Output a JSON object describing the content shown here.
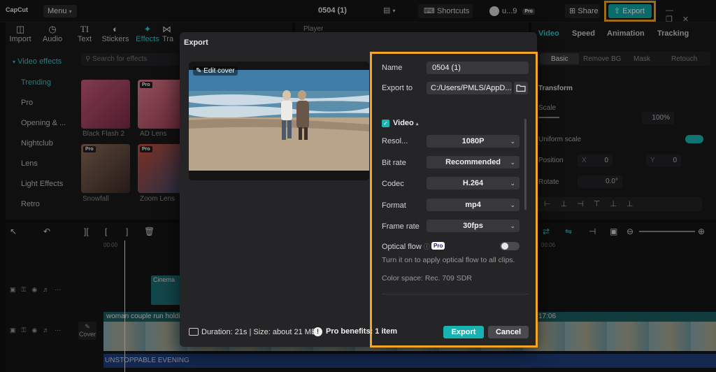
{
  "app": {
    "logo": "CapCut",
    "menu_label": "Menu",
    "project_title": "0504 (1)",
    "shortcuts_label": "Shortcuts",
    "user_label": "u...9",
    "user_badge": "Pro",
    "share_label": "Share",
    "export_label": "Export"
  },
  "toolbar_tabs": [
    {
      "label": "Import",
      "icon": "import-icon"
    },
    {
      "label": "Audio",
      "icon": "audio-icon"
    },
    {
      "label": "Text",
      "icon": "text-icon"
    },
    {
      "label": "Stickers",
      "icon": "stickers-icon"
    },
    {
      "label": "Effects",
      "icon": "effects-icon"
    },
    {
      "label": "Tra",
      "icon": "transitions-icon"
    }
  ],
  "effects_sidebar": {
    "header": "Video effects",
    "items": [
      "Trending",
      "Pro",
      "Opening & ...",
      "Nightclub",
      "Lens",
      "Light Effects",
      "Retro"
    ]
  },
  "search": {
    "placeholder": "Search for effects"
  },
  "effect_thumbs": [
    {
      "label": "Black Flash 2",
      "pro": ""
    },
    {
      "label": "AD Lens",
      "pro": "Pro"
    },
    {
      "label": "Snowfall",
      "pro": "Pro"
    },
    {
      "label": "Zoom Lens",
      "pro": "Pro"
    }
  ],
  "player": {
    "label": "Player"
  },
  "right_panel": {
    "tabs": [
      "Video",
      "Speed",
      "Animation",
      "Tracking"
    ],
    "subtabs": [
      "Basic",
      "Remove BG",
      "Mask",
      "Retouch"
    ],
    "transform_label": "Transform",
    "scale_label": "Scale",
    "scale_value": "100%",
    "uniform_scale_label": "Uniform scale",
    "position_label": "Position",
    "pos_x_label": "X",
    "pos_x_value": "0",
    "pos_y_label": "Y",
    "pos_y_value": "0",
    "rotate_label": "Rotate",
    "rotate_value": "0.0°"
  },
  "timeline": {
    "ruler_start": "00:00",
    "ruler_right": "00:06",
    "cover_label": "Cover",
    "clip_cinema": "Cinema",
    "clip_main": "woman couple run holdin",
    "clip_main_time": "17:06",
    "clip_audio": "UNSTOPPABLE EVENING"
  },
  "export_dialog": {
    "title": "Export",
    "edit_cover": "Edit cover",
    "name_label": "Name",
    "name_value": "0504 (1)",
    "export_to_label": "Export to",
    "export_to_value": "C:/Users/PMLS/AppD...",
    "video_section": "Video",
    "resolution_label": "Resol...",
    "resolution_value": "1080P",
    "bitrate_label": "Bit rate",
    "bitrate_value": "Recommended",
    "codec_label": "Codec",
    "codec_value": "H.264",
    "format_label": "Format",
    "format_value": "mp4",
    "framerate_label": "Frame rate",
    "framerate_value": "30fps",
    "optical_flow_label": "Optical flow",
    "optical_flow_badge": "Pro",
    "optical_flow_hint": "Turn it on to apply optical flow to all clips.",
    "color_space": "Color space: Rec. 709 SDR",
    "footer_info": "Duration: 21s | Size: about 21 MB",
    "pro_benefits": "Pro benefits: 1 item",
    "export_button": "Export",
    "cancel_button": "Cancel"
  },
  "colors": {
    "accent": "#18b2b2",
    "highlight": "#f5a623",
    "dialog_bg": "#252527",
    "field_bg": "#38383c"
  }
}
